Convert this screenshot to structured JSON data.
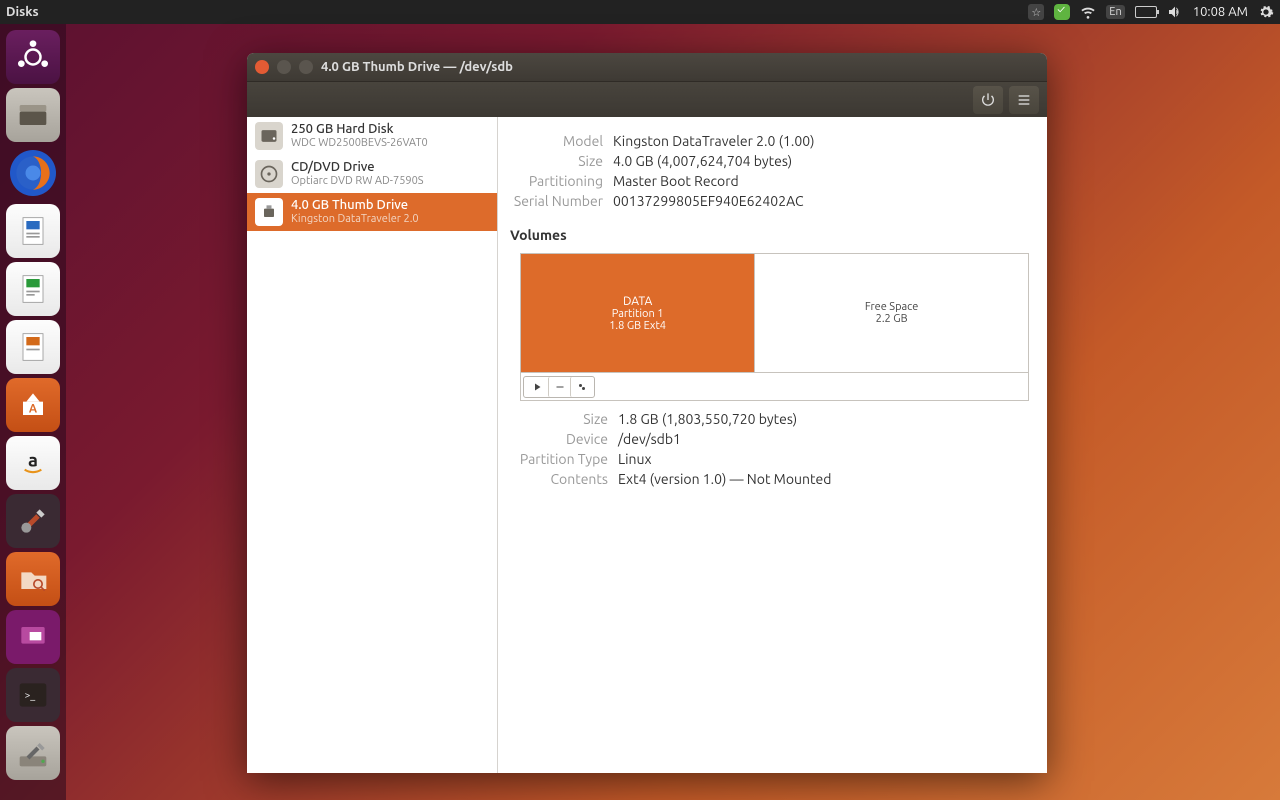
{
  "top_panel": {
    "app_name": "Disks",
    "time": "10:08 AM",
    "lang": "En"
  },
  "window": {
    "title": "4.0 GB Thumb Drive — /dev/sdb",
    "sidebar": {
      "devices": [
        {
          "title": "250 GB Hard Disk",
          "subtitle": "WDC WD2500BEVS-26VAT0",
          "icon": "hdd"
        },
        {
          "title": "CD/DVD Drive",
          "subtitle": "Optiarc DVD RW AD-7590S",
          "icon": "disc"
        },
        {
          "title": "4.0 GB Thumb Drive",
          "subtitle": "Kingston DataTraveler 2.0",
          "icon": "usb"
        }
      ]
    },
    "drive_info": {
      "model_label": "Model",
      "model": "Kingston DataTraveler 2.0 (1.00)",
      "size_label": "Size",
      "size": "4.0 GB (4,007,624,704 bytes)",
      "partitioning_label": "Partitioning",
      "partitioning": "Master Boot Record",
      "serial_label": "Serial Number",
      "serial": "00137299805EF940E62402AC"
    },
    "volumes_title": "Volumes",
    "volumes": {
      "partition": {
        "name": "DATA",
        "line2": "Partition 1",
        "line3": "1.8 GB Ext4"
      },
      "free": {
        "name": "Free Space",
        "size": "2.2 GB"
      }
    },
    "partition_info": {
      "size_label": "Size",
      "size": "1.8 GB (1,803,550,720 bytes)",
      "device_label": "Device",
      "device": "/dev/sdb1",
      "ptype_label": "Partition Type",
      "ptype": "Linux",
      "contents_label": "Contents",
      "contents": "Ext4 (version 1.0) — Not Mounted"
    }
  }
}
